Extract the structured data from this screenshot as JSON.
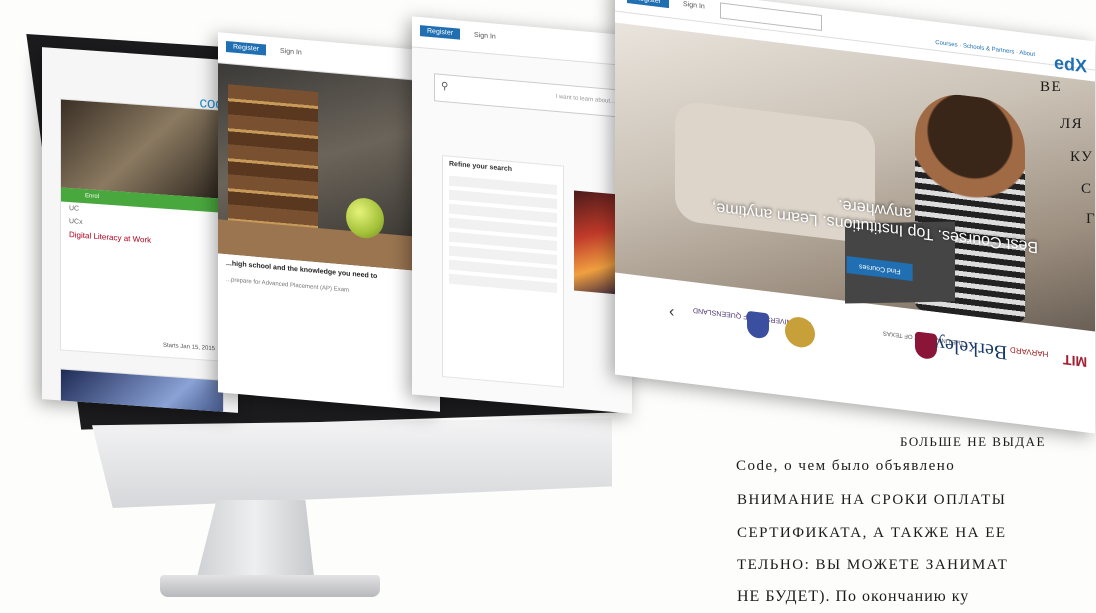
{
  "screens": {
    "panel1": {
      "heading": "coon",
      "card_badge": "Enrol",
      "card_meta_1": "UC",
      "card_meta_2": "UCx",
      "card_title": "Digital Literacy at Work",
      "card_date": "Starts Jan 15, 2015"
    },
    "panel2": {
      "register": "Register",
      "signin": "Sign In",
      "caption": "...high school and the knowledge you need to",
      "sub": "...prepare for Advanced Placement (AP) Exam"
    },
    "panel3": {
      "register": "Register",
      "signin": "Sign In",
      "search_placeholder": "I want to learn about...",
      "refine_title": "Refine your search"
    },
    "panel4": {
      "register": "Register",
      "signin": "Sign In",
      "nav_links": "Courses · Schools & Partners · About",
      "logo": "edX",
      "tagline": "Best Courses. Top Institutions. Learn anytime, anywhere.",
      "find_button": "Find Courses",
      "partners": [
        "MIT",
        "HARVARD",
        "Berkeley",
        "THE UNIVERSITY OF TEXAS",
        "THE UNIVERSITY OF QUEENSLAND"
      ]
    }
  },
  "book_text": {
    "right_lines": [
      "ВЕ",
      "ЛЯ",
      "КУ",
      "С",
      "Г"
    ],
    "bottom_lines": [
      "БОЛЬШЕ НЕ ВЫДАЕ",
      "Code, о чем было объявлено",
      "ВНИМАНИЕ НА СРОКИ ОПЛАТЫ",
      "СЕРТИФИКАТА, А ТАКЖЕ НА ЕЕ",
      "ТЕЛЬНО: ВЫ МОЖЕТЕ ЗАНИМАТ",
      "НЕ БУДЕТ). По окончанию ку"
    ]
  }
}
